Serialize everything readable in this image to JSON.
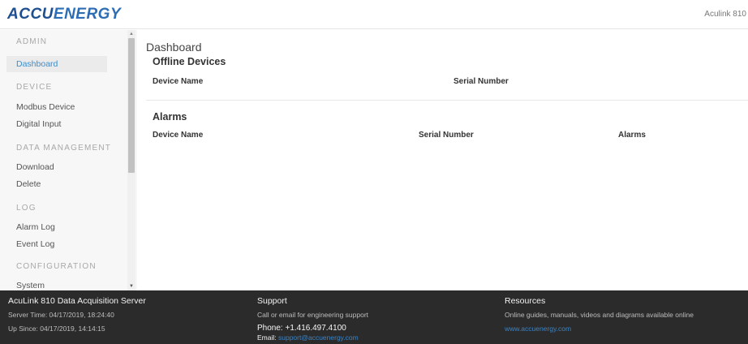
{
  "header": {
    "logo_text_a": "ACCU",
    "logo_text_b": "ENERGY",
    "device_label": "Aculink 810"
  },
  "sidebar": {
    "sections": [
      {
        "title": "ADMIN",
        "items": [
          "Dashboard"
        ]
      },
      {
        "title": "DEVICE",
        "items": [
          "Modbus Device",
          "Digital Input"
        ]
      },
      {
        "title": "DATA MANAGEMENT",
        "items": [
          "Download",
          "Delete"
        ]
      },
      {
        "title": "LOG",
        "items": [
          "Alarm Log",
          "Event Log"
        ]
      },
      {
        "title": "CONFIGURATION",
        "items": [
          "System"
        ]
      }
    ],
    "active_item": "Dashboard",
    "scroll_up_glyph": "▲",
    "scroll_down_glyph": "▼"
  },
  "main": {
    "page_title": "Dashboard",
    "offline": {
      "title": "Offline Devices",
      "columns": [
        "Device Name",
        "Serial Number"
      ]
    },
    "alarms": {
      "title": "Alarms",
      "columns": [
        "Device Name",
        "Serial Number",
        "Alarms"
      ]
    }
  },
  "footer": {
    "server": {
      "title": "AcuLink 810 Data Acquisition Server",
      "server_time": "Server Time: 04/17/2019, 18:24:40",
      "up_since": "Up Since: 04/17/2019, 14:14:15"
    },
    "support": {
      "title": "Support",
      "text": "Call or email for engineering support",
      "phone": "Phone: +1.416.497.4100",
      "email_label": "Email:",
      "email": "support@accuenergy.com"
    },
    "resources": {
      "title": "Resources",
      "text": "Online guides, manuals, videos and diagrams available online",
      "link": "www.accuenergy.com"
    }
  },
  "colors": {
    "brand_blue": "#1d4f91",
    "link_blue": "#3a8fcf",
    "footer_bg": "#2b2b2b"
  }
}
